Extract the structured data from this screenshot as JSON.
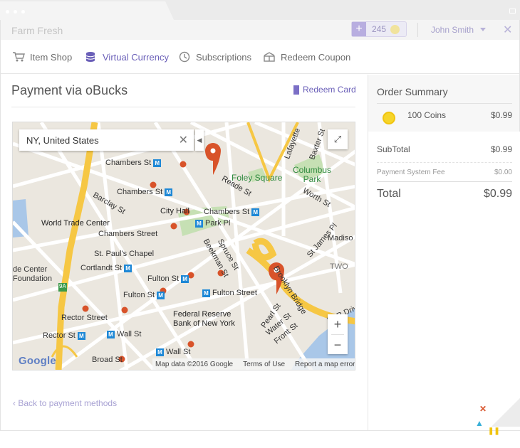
{
  "app": {
    "title": "Farm Fresh",
    "coins": "245",
    "user_name": "John Smith"
  },
  "nav": {
    "items": [
      {
        "label": "Item Shop",
        "icon": "cart-icon"
      },
      {
        "label": "Virtual Currency",
        "icon": "coins-stack-icon",
        "active": true
      },
      {
        "label": "Subscriptions",
        "icon": "clock-icon"
      },
      {
        "label": "Redeem Coupon",
        "icon": "coupon-icon"
      }
    ]
  },
  "payment": {
    "title": "Payment via oBucks",
    "redeem_card": "Redeem Card",
    "back_link": "Back to payment methods"
  },
  "map": {
    "search_value": "NY, United States",
    "labels": {
      "chambers_st_1": "Chambers St",
      "chambers_st_2": "Chambers St",
      "chambers_st_3": "Chambers St",
      "chambers_street": "Chambers Street",
      "reade_st": "Reade St",
      "foley_square": "Foley Square",
      "lafayette": "Lafayette",
      "baxter_st": "Baxter St",
      "columbus_park": "Columbus\nPark",
      "worth_st": "Worth St",
      "barclay_st": "Barclay St",
      "city_hall": "City Hall",
      "park_pl": "Park Pl",
      "world_trade_center": "World Trade Center",
      "st_pauls_chapel": "St. Paul's Chapel",
      "spruce_st": "Spruce St",
      "beekman_st": "Beekman St",
      "cortlandt_st": "Cortlandt St",
      "fulton_st_1": "Fulton St",
      "fulton_st_2": "Fulton St",
      "fulton_street": "Fulton Street",
      "brooklyn_bridge": "Brooklyn Bridge",
      "st_james_pl": "St James Pl",
      "madison": "Madiso",
      "two": "TWO",
      "federal_reserve": "Federal Reserve\nBank of New York",
      "rector_street": "Rector Street",
      "rector_st": "Rector St",
      "wall_st_1": "Wall St",
      "wall_st_2": "Wall St",
      "broad_st": "Broad St",
      "pearl_st": "Pearl St",
      "water_st": "Water St",
      "front_st": "Front St",
      "fdr_drive": "FDR Driv",
      "center": "de Center\nFoundation",
      "route_9a": "9A"
    },
    "footer": {
      "data": "Map data ©2016 Google",
      "terms": "Terms of Use",
      "report": "Report a map error"
    },
    "google": "Google"
  },
  "summary": {
    "title": "Order Summary",
    "item_label": "100 Coins",
    "item_price": "$0.99",
    "subtotal_label": "SubTotal",
    "subtotal_value": "$0.99",
    "fee_label": "Payment System Fee",
    "fee_value": "$0.00",
    "total_label": "Total",
    "total_value": "$0.99"
  },
  "colors": {
    "accent": "#6a5fb8",
    "pin": "#d8532a",
    "coin": "#f6d52a",
    "road_major": "#f6c744",
    "park": "#c6e0b4"
  }
}
